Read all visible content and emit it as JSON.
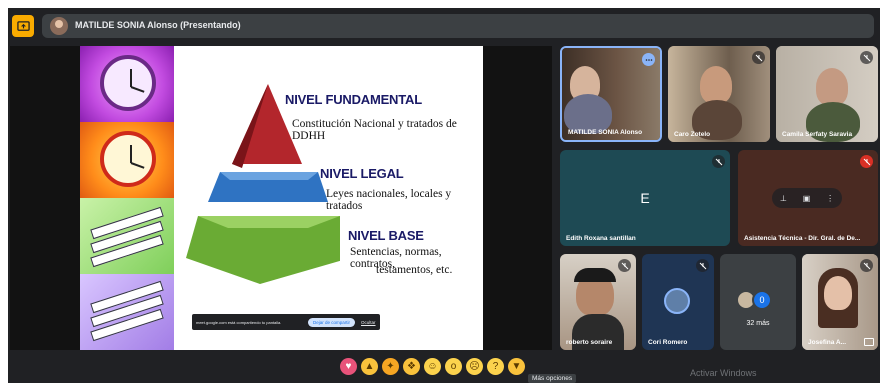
{
  "topbar": {
    "presenter_label": "MATILDE SONIA Alonso (Presentando)"
  },
  "slide": {
    "levels": [
      {
        "title": "NIVEL FUNDAMENTAL",
        "subtitle": "Constitución Nacional y tratados de DDHH",
        "color": "#c0262e"
      },
      {
        "title": "NIVEL LEGAL",
        "subtitle": "Leyes nacionales, locales y tratados",
        "color": "#2a6fbf"
      },
      {
        "title": "NIVEL BASE",
        "subtitle": "Sentencias, normas, contratos,",
        "subtitle2": "testamentos, etc.",
        "color": "#6aa832"
      }
    ],
    "share_bar": {
      "message": "meet.google.com está compartiendo tu pantalla.",
      "stop_label": "Dejar de compartir",
      "hide_label": "Ocultar"
    }
  },
  "participants": [
    {
      "name": "MATILDE SONIA Alonso",
      "bg": "#5a4a3c",
      "state": "more"
    },
    {
      "name": "Caro Zotelo",
      "bg": "#8b7b68",
      "state": "muted"
    },
    {
      "name": "Camila Serfaty Saravia",
      "bg": "#9a938a",
      "state": "muted"
    },
    {
      "name": "Edith Roxana santillan",
      "initial": "E",
      "bg": "#1e4a54",
      "state": "muted"
    },
    {
      "name": "Asistencia Técnica - Dir. Gral. de De...",
      "bg": "#4a2a22",
      "state": "muted"
    },
    {
      "name": "roberto soraire",
      "bg": "#6b5448",
      "state": "muted"
    },
    {
      "name": "Cori Romero",
      "bg": "#1f3554",
      "state": "muted"
    },
    {
      "name": "32 más",
      "count": "0",
      "bg": "#3c4043"
    },
    {
      "name": "Josefina A...",
      "bg": "#bfb3a8",
      "state": "muted"
    }
  ],
  "reactions": [
    "heart",
    "thumbs-up",
    "party-popper",
    "clap",
    "laugh",
    "surprised",
    "sad",
    "thinking",
    "thumbs-down"
  ],
  "tooltip": "Más opciones",
  "watermark": "Activar Windows"
}
